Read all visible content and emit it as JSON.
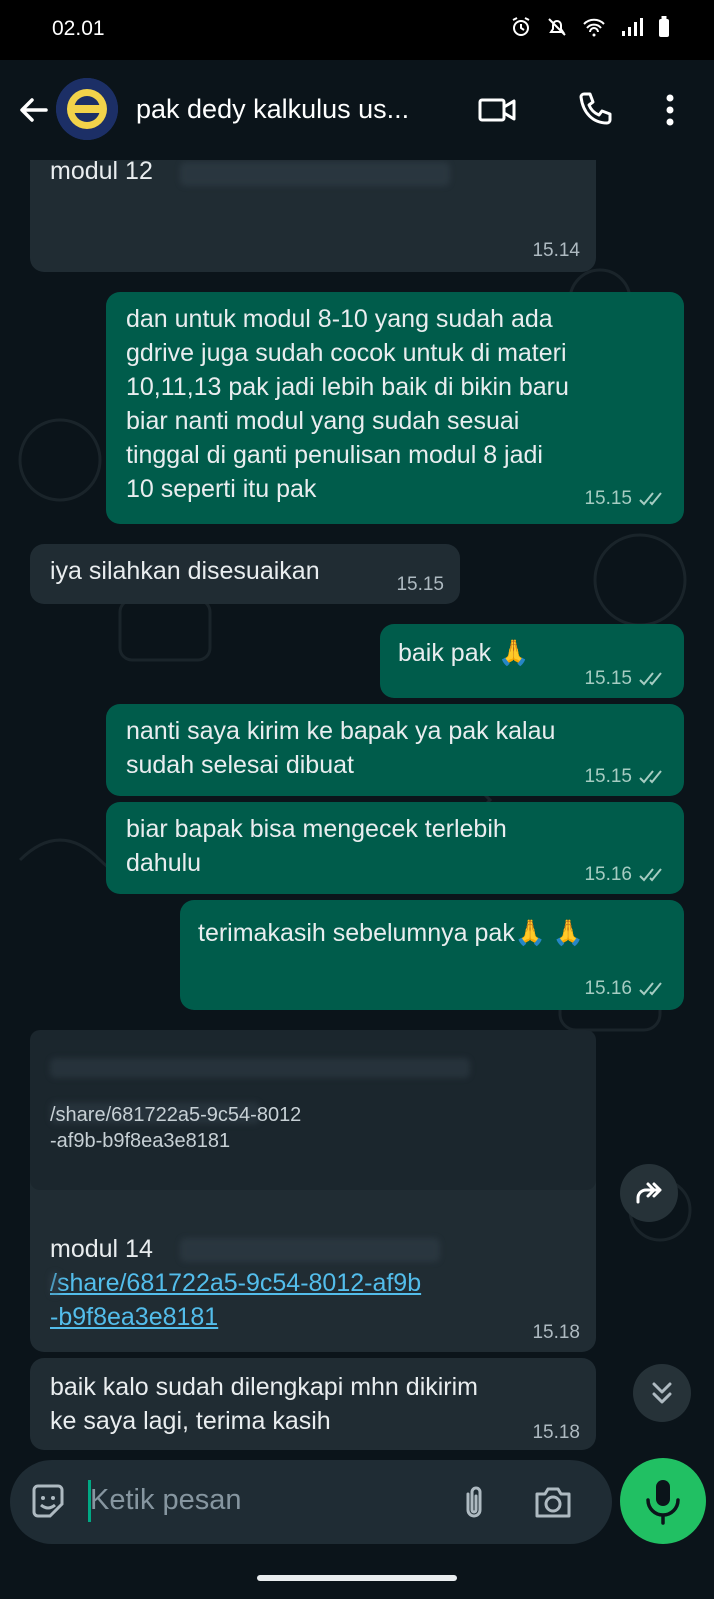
{
  "status": {
    "time": "02.01"
  },
  "header": {
    "title": "pak dedy kalkulus us..."
  },
  "messages": {
    "m1": {
      "text": "modul 12",
      "time": "15.14"
    },
    "m2": {
      "text": "dan untuk modul 8-10 yang sudah ada\ngdrive juga sudah cocok untuk di materi\n10,11,13 pak jadi lebih baik di bikin baru\nbiar nanti modul yang sudah sesuai\ntinggal di ganti penulisan modul 8 jadi\n10 seperti itu pak",
      "time": "15.15"
    },
    "m3": {
      "text": "iya silahkan disesuaikan",
      "time": "15.15"
    },
    "m4": {
      "text": "baik pak 🙏",
      "time": "15.15"
    },
    "m5": {
      "text": "nanti saya kirim ke bapak ya pak kalau\nsudah selesai dibuat",
      "time": "15.15"
    },
    "m6": {
      "text": "biar bapak bisa mengecek terlebih\ndahulu",
      "time": "15.16"
    },
    "m7": {
      "text": "terimakasih sebelumnya pak🙏 🙏",
      "time": "15.16"
    },
    "m8": {
      "preview_text": "/share/681722a5-9c54-8012\n-af9b-b9f8ea3e8181",
      "text": "modul 14",
      "link": "/share/681722a5-9c54-8012-af9b\n-b9f8ea3e8181",
      "time": "15.18"
    },
    "m9": {
      "text": "baik kalo sudah dilengkapi mhn dikirim\nke saya lagi, terima kasih",
      "time": "15.18"
    }
  },
  "input": {
    "placeholder": "Ketik pesan"
  },
  "colors": {
    "incoming": "#202c33",
    "outgoing": "#005c4b",
    "accent": "#21c063",
    "link": "#53bdeb"
  },
  "icons": [
    "alarm-icon",
    "bell-off-icon",
    "wifi-icon",
    "signal-icon",
    "battery-icon",
    "back-arrow-icon",
    "video-call-icon",
    "phone-icon",
    "more-vert-icon",
    "read-ticks-icon",
    "forward-icon",
    "scroll-down-icon",
    "sticker-icon",
    "attach-icon",
    "camera-icon",
    "mic-icon"
  ]
}
